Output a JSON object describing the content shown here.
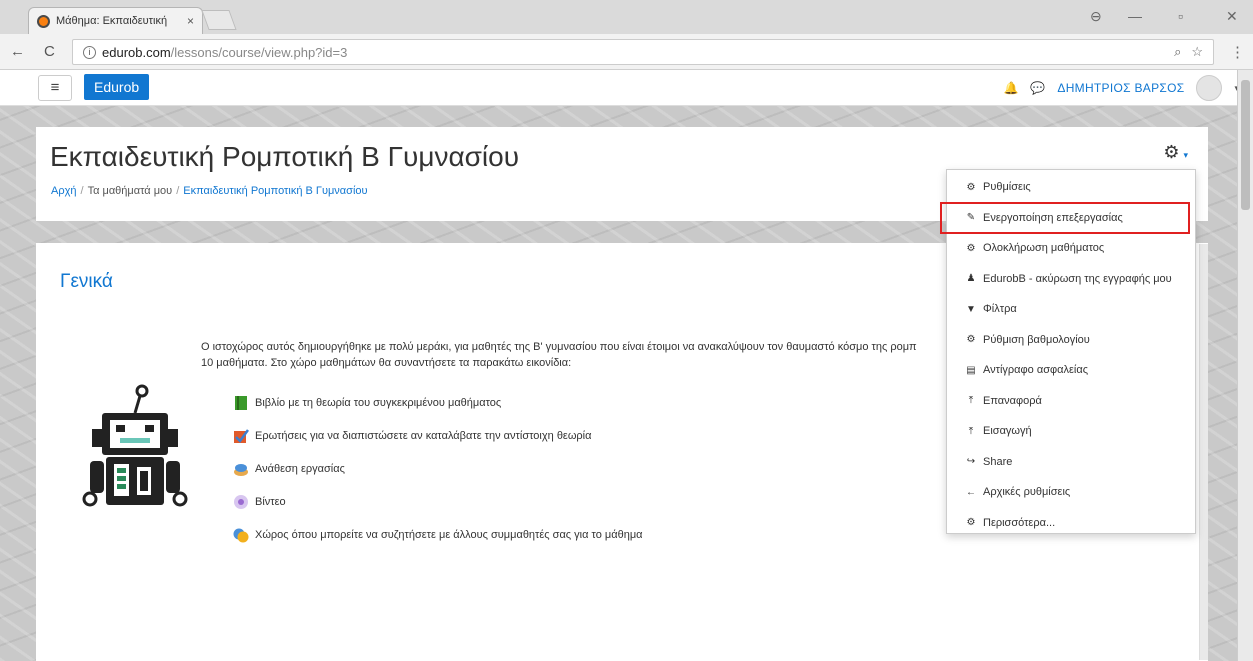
{
  "browser": {
    "tab_title": "Μάθημα: Εκπαιδευτική",
    "tab_close": "×",
    "url_host": "edurob.com",
    "url_path": "/lessons/course/view.php?id=3",
    "back": "←",
    "reload": "C",
    "info": "i",
    "zoom": "⌕",
    "star": "☆",
    "menu": "⋮",
    "account": "⊖",
    "minimize": "—",
    "maximize": "▫",
    "close": "✕"
  },
  "navbar": {
    "menu": "≡",
    "brand": "Edurob",
    "user_name": "ΔΗΜΗΤΡΙΟΣ ΒΑΡΣΟΣ",
    "bell": "🔔",
    "message": "💬",
    "caret": "▾"
  },
  "header": {
    "course_title": "Εκπαιδευτική Ρομποτική Β Γυμνασίου",
    "breadcrumb": [
      "Αρχή",
      "Τα μαθήματά μου",
      "Εκπαιδευτική Ρομποτική Β Γυμνασίου"
    ],
    "separator": "/",
    "gear": "⚙",
    "gear_caret": "▾"
  },
  "section": {
    "title": "Γενικά",
    "intro_line1": "Ο ιστοχώρος αυτός δημιουργήθηκε με πολύ μεράκι, για μαθητές της Β' γυμνασίου που είναι έτοιμοι να ανακαλύψουν τον θαυμαστό κόσμο της ρομπ",
    "intro_line2": "10 μαθήματα. Στο χώρο μαθημάτων θα συναντήσετε τα παρακάτω εικονίδια:",
    "legend": [
      {
        "icon": "book-icon",
        "color": "#3a9a2a",
        "label": "Βιβλίο με τη θεωρία του συγκεκριμένου μαθήματος"
      },
      {
        "icon": "quiz-check-icon",
        "color": "#e05a2b",
        "label": "Ερωτήσεις για να διαπιστώσετε αν καταλάβατε την αντίστοιχη θεωρία"
      },
      {
        "icon": "assignment-icon",
        "color": "#4a90d9",
        "label": "Ανάθεση εργασίας"
      },
      {
        "icon": "video-icon",
        "color": "#9a6ad1",
        "label": "Βίντεο"
      },
      {
        "icon": "forum-icon",
        "color": "#f2b01e",
        "label": "Χώρος όπου μπορείτε να συζητήσετε με άλλους συμμαθητές σας για το μάθημα"
      }
    ]
  },
  "dropdown": {
    "items": [
      {
        "icon": "⚙",
        "label": "Ρυθμίσεις"
      },
      {
        "icon": "✎",
        "label": "Ενεργοποίηση επεξεργασίας"
      },
      {
        "icon": "⚙",
        "label": "Ολοκλήρωση μαθήματος"
      },
      {
        "icon": "♟",
        "label": "EdurobB - ακύρωση της εγγραφής μου"
      },
      {
        "icon": "▼",
        "label": "Φίλτρα"
      },
      {
        "icon": "⚙",
        "label": "Ρύθμιση βαθμολογίου"
      },
      {
        "icon": "▤",
        "label": "Αντίγραφο ασφαλείας"
      },
      {
        "icon": "⤒",
        "label": "Επαναφορά"
      },
      {
        "icon": "⤒",
        "label": "Εισαγωγή"
      },
      {
        "icon": "↪",
        "label": "Share"
      },
      {
        "icon": "←",
        "label": "Αρχικές ρυθμίσεις"
      },
      {
        "icon": "⚙",
        "label": "Περισσότερα..."
      }
    ],
    "highlight_color": "#e02020"
  },
  "colors": {
    "accent": "#1177d1"
  }
}
